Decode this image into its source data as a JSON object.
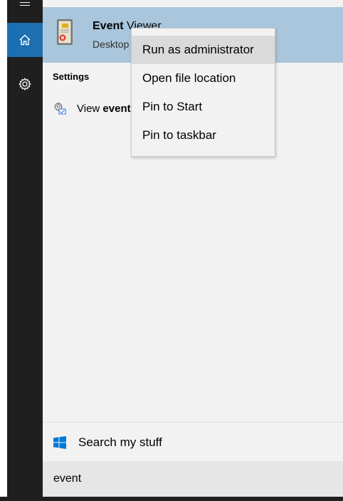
{
  "app": "Windows 10 Start Search",
  "best_match": {
    "title_bold": "Event",
    "title_rest": " Viewer",
    "subtitle": "Desktop app"
  },
  "settings": {
    "heading": "Settings",
    "item_prefix": "View ",
    "item_bold": "event logs"
  },
  "context_menu": {
    "items": [
      {
        "label": "Run as administrator",
        "highlighted": true
      },
      {
        "label": "Open file location",
        "highlighted": false
      },
      {
        "label": "Pin to Start",
        "highlighted": false
      },
      {
        "label": "Pin to taskbar",
        "highlighted": false
      }
    ]
  },
  "search_my_stuff": {
    "label": "Search my stuff"
  },
  "search_box": {
    "value": "event"
  },
  "icons": {
    "hamburger": "menu-icon",
    "home": "home-icon",
    "settings": "gear-icon",
    "event_viewer": "event-viewer-app-icon",
    "setting_item": "settings-page-icon",
    "search_my_stuff": "windows-logo-icon"
  },
  "colors": {
    "rail": "#1f1f1f",
    "home_active": "#1c6fb0",
    "best_match_bg": "#a9c6dc",
    "menu_highlight": "#dadada",
    "panel_bg": "#f2f2f2",
    "windows_logo": "#0078d7"
  }
}
